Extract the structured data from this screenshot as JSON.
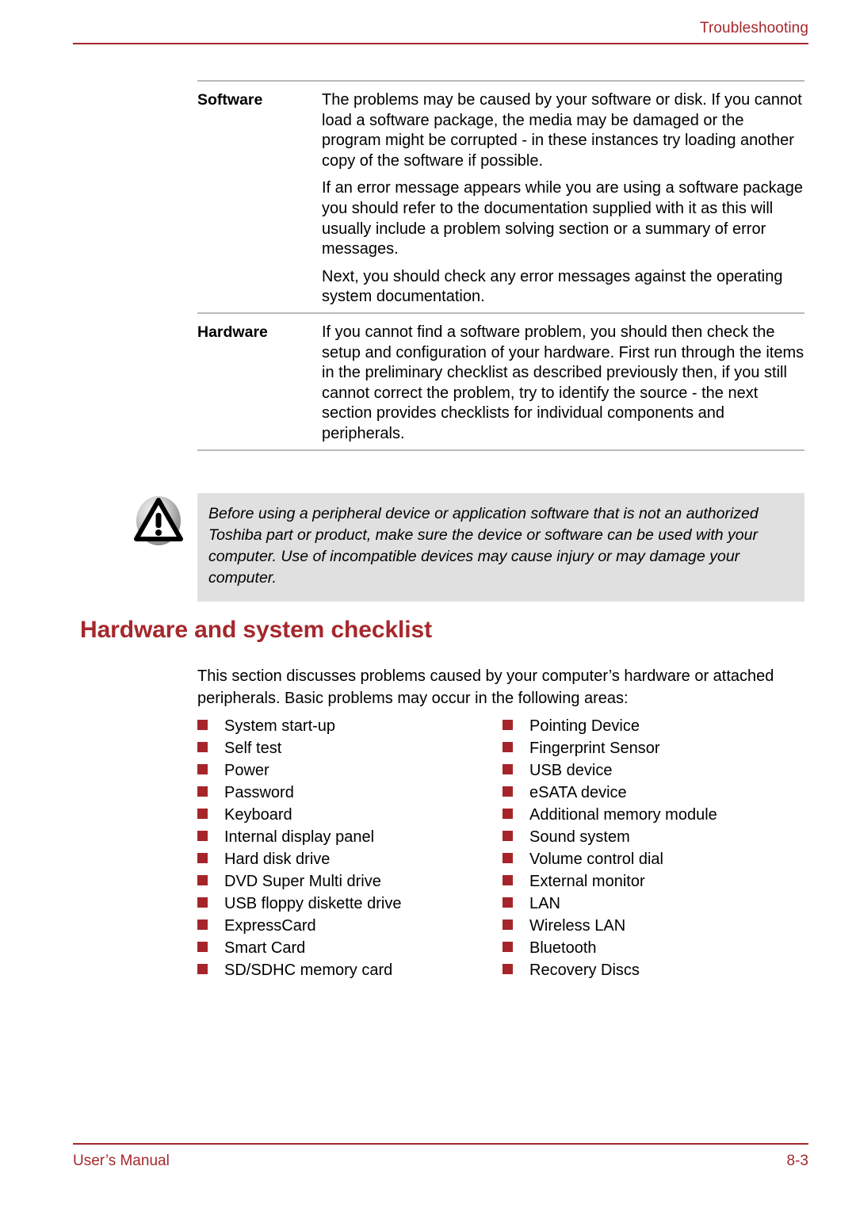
{
  "header": {
    "chapter_title": "Troubleshooting"
  },
  "definition_table": {
    "rows": [
      {
        "term": "Software",
        "paragraphs": [
          "The problems may be caused by your software or disk. If you cannot load a software package, the media may be damaged or the program might be corrupted - in these instances try loading another copy of the software if possible.",
          "If an error message appears while you are using a software package you should refer to the documentation supplied with it as this will usually include a problem solving section or a summary of error messages.",
          "Next, you should check any error messages against the operating system documentation."
        ]
      },
      {
        "term": "Hardware",
        "paragraphs": [
          "If you cannot find a software problem, you should then check the setup and configuration of your hardware. First run through the items in the preliminary checklist as described previously then, if you still cannot correct the problem, try to identify the source - the next section provides checklists for individual components and peripherals."
        ]
      }
    ]
  },
  "callout": {
    "icon": "warning-triangle-icon",
    "text": "Before using a peripheral device or application software that is not an authorized Toshiba part or product, make sure the device or software can be used with your computer. Use of incompatible devices may cause injury or may damage your computer."
  },
  "section": {
    "heading": "Hardware and system checklist",
    "intro": "This section discusses problems caused by your computer’s hardware or attached peripherals. Basic problems may occur in the following areas:"
  },
  "checklist": {
    "left_column": [
      "System start-up",
      "Self test",
      "Power",
      "Password",
      "Keyboard",
      "Internal display panel",
      "Hard disk drive",
      "DVD Super Multi drive",
      "USB floppy diskette drive",
      "ExpressCard",
      "Smart Card",
      "SD/SDHC memory card"
    ],
    "right_column": [
      "Pointing Device",
      "Fingerprint Sensor",
      "USB device",
      "eSATA device",
      "Additional memory module",
      "Sound system",
      "Volume control dial",
      "External monitor",
      "LAN",
      "Wireless LAN",
      "Bluetooth",
      "Recovery Discs"
    ]
  },
  "footer": {
    "manual_label": "User’s Manual",
    "page_number": "8-3"
  },
  "colors": {
    "accent_red": "#a5282c",
    "bullet_red": "#a5252a",
    "callout_background": "#e0e0e0",
    "rule_gray": "#b9b9b9"
  }
}
